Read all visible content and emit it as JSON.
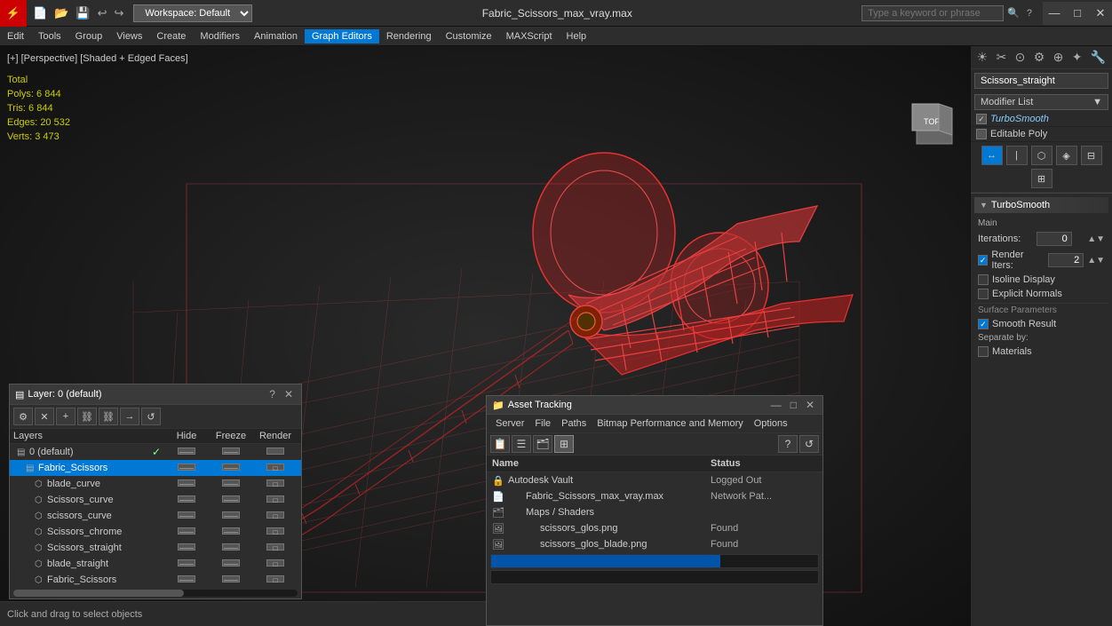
{
  "titlebar": {
    "logo_text": "⚡",
    "filename": "Fabric_Scissors_max_vray.max",
    "workspace_label": "Workspace: Default",
    "search_placeholder": "Type a keyword or phrase",
    "minimize": "—",
    "maximize": "□",
    "close": "✕"
  },
  "menubar": {
    "items": [
      "Edit",
      "Tools",
      "Group",
      "Views",
      "Create",
      "Modifiers",
      "Animation",
      "Graph Editors",
      "Rendering",
      "Customize",
      "MAXScript",
      "Help"
    ]
  },
  "viewport": {
    "label": "[+] [Perspective] [Shaded + Edged Faces]",
    "stats": {
      "polys_label": "Polys:",
      "polys_value": "6 844",
      "tris_label": "Tris:",
      "tris_value": "6 844",
      "edges_label": "Edges:",
      "edges_value": "20 532",
      "verts_label": "Verts:",
      "verts_value": "3 473",
      "total_label": "Total"
    }
  },
  "right_panel": {
    "object_name": "Scissors_straight",
    "modifier_list_label": "Modifier List",
    "modifiers": [
      {
        "name": "TurboSmooth",
        "italic": true,
        "checked": true
      },
      {
        "name": "Editable Poly",
        "italic": false,
        "checked": false
      }
    ],
    "turbosmooth": {
      "title": "TurboSmooth",
      "main_label": "Main",
      "iterations_label": "Iterations:",
      "iterations_value": "0",
      "render_iters_label": "Render Iters:",
      "render_iters_value": "2",
      "isoline_display_label": "Isoline Display",
      "explicit_normals_label": "Explicit Normals",
      "surface_params_label": "Surface Parameters",
      "smooth_result_label": "Smooth Result",
      "smooth_result_checked": true,
      "separate_by_label": "Separate by:",
      "materials_label": "Materials",
      "materials_checked": false
    }
  },
  "layers_panel": {
    "title": "Layer: 0 (default)",
    "question_btn": "?",
    "close_btn": "✕",
    "col_headers": {
      "name": "Layers",
      "hide": "Hide",
      "freeze": "Freeze",
      "render": "Render"
    },
    "layers": [
      {
        "name": "0 (default)",
        "indent": 0,
        "icon": "▤",
        "checked": true,
        "selected": false
      },
      {
        "name": "Fabric_Scissors",
        "indent": 1,
        "icon": "▤",
        "checked": false,
        "selected": true
      },
      {
        "name": "blade_curve",
        "indent": 2,
        "icon": "⬡",
        "checked": false,
        "selected": false
      },
      {
        "name": "Scissors_curve",
        "indent": 2,
        "icon": "⬡",
        "checked": false,
        "selected": false
      },
      {
        "name": "scissors_curve",
        "indent": 2,
        "icon": "⬡",
        "checked": false,
        "selected": false
      },
      {
        "name": "Scissors_chrome",
        "indent": 2,
        "icon": "⬡",
        "checked": false,
        "selected": false
      },
      {
        "name": "Scissors_straight",
        "indent": 2,
        "icon": "⬡",
        "checked": false,
        "selected": false
      },
      {
        "name": "blade_straight",
        "indent": 2,
        "icon": "⬡",
        "checked": false,
        "selected": false
      },
      {
        "name": "Fabric_Scissors",
        "indent": 2,
        "icon": "⬡",
        "checked": false,
        "selected": false
      }
    ]
  },
  "asset_panel": {
    "title": "Asset Tracking",
    "title_icon": "📁",
    "menus": [
      "Server",
      "File",
      "Paths",
      "Bitmap Performance and Memory",
      "Options"
    ],
    "col_name": "Name",
    "col_status": "Status",
    "assets": [
      {
        "name": "Autodesk Vault",
        "indent": 0,
        "icon": "🔒",
        "status": "Logged Out"
      },
      {
        "name": "Fabric_Scissors_max_vray.max",
        "indent": 1,
        "icon": "📄",
        "status": "Network Pat..."
      },
      {
        "name": "Maps / Shaders",
        "indent": 1,
        "icon": "🗂",
        "status": ""
      },
      {
        "name": "scissors_glos.png",
        "indent": 2,
        "icon": "🖼",
        "status": "Found"
      },
      {
        "name": "scissors_glos_blade.png",
        "indent": 2,
        "icon": "🖼",
        "status": "Found"
      }
    ]
  }
}
